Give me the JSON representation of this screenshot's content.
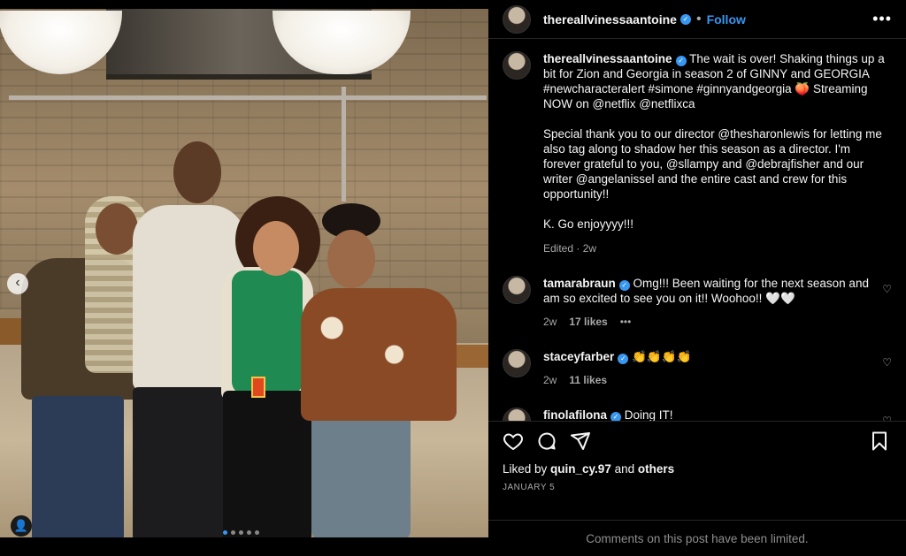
{
  "post": {
    "username": "thereallvinessaantoine",
    "follow_label": "Follow",
    "more_label": "•••"
  },
  "caption": {
    "username": "thereallvinessaantoine",
    "line1": "The wait is over! Shaking things up a bit for Zion and Georgia in season 2 of GINNY and GEORGIA #newcharacteralert #simone #ginnyandgeorgia 🍑 Streaming NOW on @netflix @netflixca",
    "paragraph2": "Special thank you to our director @thesharonlewis for letting me also tag along to shadow her this season as a director. I'm forever grateful to you, @sllampy and @debrajfisher and our writer @angelanissel and the entire cast and crew for this opportunity!!",
    "paragraph3": "K. Go enjoyyyy!!!",
    "meta": "Edited · 2w"
  },
  "comments": [
    {
      "username": "tamarabraun",
      "text": "Omg!!! Been waiting for the next season and am so excited to see you on it!! Woohoo!! 🤍🤍",
      "time": "2w",
      "likes": "17 likes",
      "more": "•••"
    },
    {
      "username": "staceyfarber",
      "text": "👏👏👏👏",
      "time": "2w",
      "likes": "11 likes"
    },
    {
      "username": "finolafilona",
      "text": "Doing IT!"
    }
  ],
  "actions": {
    "liked_by_prefix": "Liked by ",
    "liked_by_user": "quin_cy.97",
    "liked_by_and": " and ",
    "liked_by_others": "others",
    "date": "JANUARY 5"
  },
  "footer": {
    "limited": "Comments on this post have been limited."
  },
  "colors": {
    "accent": "#3897f0",
    "background": "#000000",
    "muted": "#a8a8a8"
  },
  "photo": {
    "carousel_dots": 5,
    "active_dot": 0
  }
}
